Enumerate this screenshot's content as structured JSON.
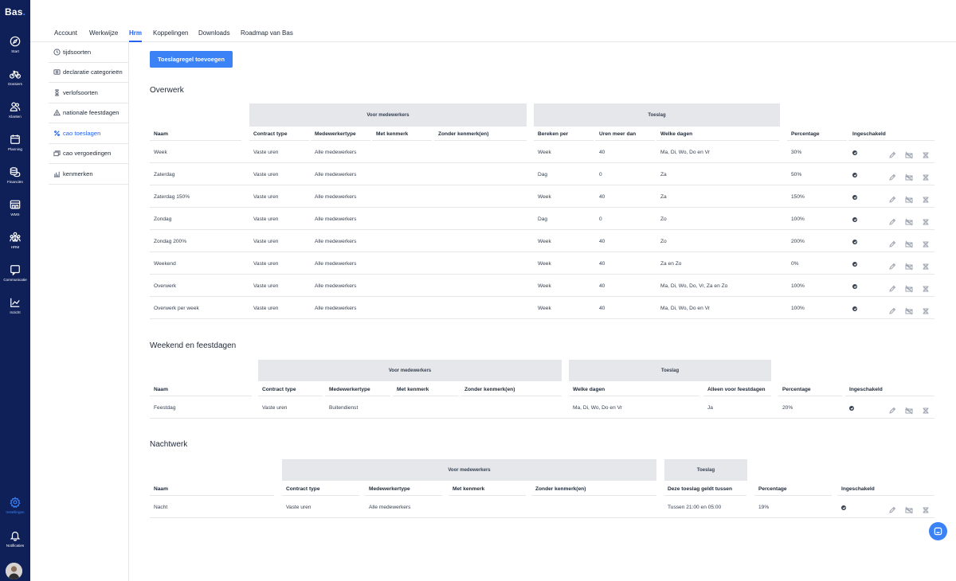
{
  "app": {
    "logo": "Bas",
    "logo_dot": "."
  },
  "rail": [
    {
      "label": "Start",
      "icon": "compass-icon"
    },
    {
      "label": "Dossiers",
      "icon": "bicycle-icon"
    },
    {
      "label": "Klanten",
      "icon": "users-icon"
    },
    {
      "label": "Planning",
      "icon": "calendar-icon"
    },
    {
      "label": "Financiën",
      "icon": "coins-icon"
    },
    {
      "label": "WMS",
      "icon": "warehouse-icon"
    },
    {
      "label": "HRM",
      "icon": "team-icon"
    },
    {
      "label": "Communicatie",
      "icon": "chat-bubble-icon"
    },
    {
      "label": "Inzicht",
      "icon": "line-chart-icon"
    },
    {
      "label": "Instellingen",
      "icon": "gear-icon",
      "active": true
    },
    {
      "label": "Notificaties",
      "icon": "bell-icon"
    }
  ],
  "tabs": [
    "Account",
    "Werkwijze",
    "Hrm",
    "Koppelingen",
    "Downloads",
    "Roadmap van Bas"
  ],
  "active_tab": "Hrm",
  "subnav": [
    {
      "label": "tijdsoorten",
      "icon": "clock-icon"
    },
    {
      "label": "declaratie categorieën",
      "icon": "receipt-icon"
    },
    {
      "label": "verlofsoorten",
      "icon": "hourglass-icon"
    },
    {
      "label": "nationale feestdagen",
      "icon": "tent-icon"
    },
    {
      "label": "cao toeslagen",
      "icon": "percent-icon",
      "active": true
    },
    {
      "label": "cao vergoedingen",
      "icon": "money-icon"
    },
    {
      "label": "kenmerken",
      "icon": "tags-icon"
    }
  ],
  "add_button": "Toeslagregel toevoegen",
  "overwerk": {
    "title": "Overwerk",
    "group_left": "Voor medewerkers",
    "group_right": "Toeslag",
    "headers": [
      "Naam",
      "Contract type",
      "Medewerkertype",
      "Met kenmerk",
      "Zonder kenmerk(en)",
      "Bereken per",
      "Uren meer dan",
      "Welke dagen",
      "Percentage",
      "Ingeschakeld"
    ],
    "rows": [
      [
        "Week",
        "Vaste uren",
        "Alle medewerkers",
        "",
        "",
        "Week",
        "40",
        "Ma, Di, Wo, Do en Vr",
        "30%"
      ],
      [
        "Zaterdag",
        "Vaste uren",
        "Alle medewerkers",
        "",
        "",
        "Dag",
        "0",
        "Za",
        "50%"
      ],
      [
        "Zaterdag 150%",
        "Vaste uren",
        "Alle medewerkers",
        "",
        "",
        "Week",
        "40",
        "Za",
        "150%"
      ],
      [
        "Zondag",
        "Vaste uren",
        "Alle medewerkers",
        "",
        "",
        "Dag",
        "0",
        "Zo",
        "100%"
      ],
      [
        "Zondag 200%",
        "Vaste uren",
        "Alle medewerkers",
        "",
        "",
        "Week",
        "40",
        "Zo",
        "200%"
      ],
      [
        "Weekend",
        "Vaste uren",
        "Alle medewerkers",
        "",
        "",
        "Week",
        "40",
        "Za en Zo",
        "0%"
      ],
      [
        "Overwerk",
        "Vaste uren",
        "Alle medewerkers",
        "",
        "",
        "Week",
        "40",
        "Ma, Di, Wo, Do, Vr, Za en Zo",
        "100%"
      ],
      [
        "Overwerk per week",
        "Vaste uren",
        "Alle medewerkers",
        "",
        "",
        "Week",
        "40",
        "Ma, Di, Wo, Do en Vr",
        "100%"
      ]
    ]
  },
  "weekend": {
    "title": "Weekend en feestdagen",
    "group_left": "Voor medewerkers",
    "group_right": "Toeslag",
    "headers": [
      "Naam",
      "Contract type",
      "Medewerkertype",
      "Met kenmerk",
      "Zonder kenmerk(en)",
      "Welke dagen",
      "Alleen voor feestdagen",
      "Percentage",
      "Ingeschakeld"
    ],
    "rows": [
      [
        "Feestdag",
        "Vaste uren",
        "Buitendienst",
        "",
        "",
        "Ma, Di, Wo, Do en Vr",
        "Ja",
        "20%"
      ]
    ]
  },
  "nacht": {
    "title": "Nachtwerk",
    "group_left": "Voor medewerkers",
    "group_right": "Toeslag",
    "headers": [
      "Naam",
      "Contract type",
      "Medewerkertype",
      "Met kenmerk",
      "Zonder kenmerk(en)",
      "Deze toeslag geldt tussen",
      "Percentage",
      "Ingeschakeld"
    ],
    "rows": [
      [
        "Nacht",
        "Vaste uren",
        "Alle medewerkers",
        "",
        "",
        "Tussen 21:00 en 05:00",
        "19%"
      ]
    ]
  },
  "row_actions": [
    {
      "name": "edit-icon"
    },
    {
      "name": "disable-icon"
    },
    {
      "name": "delete-icon"
    }
  ]
}
